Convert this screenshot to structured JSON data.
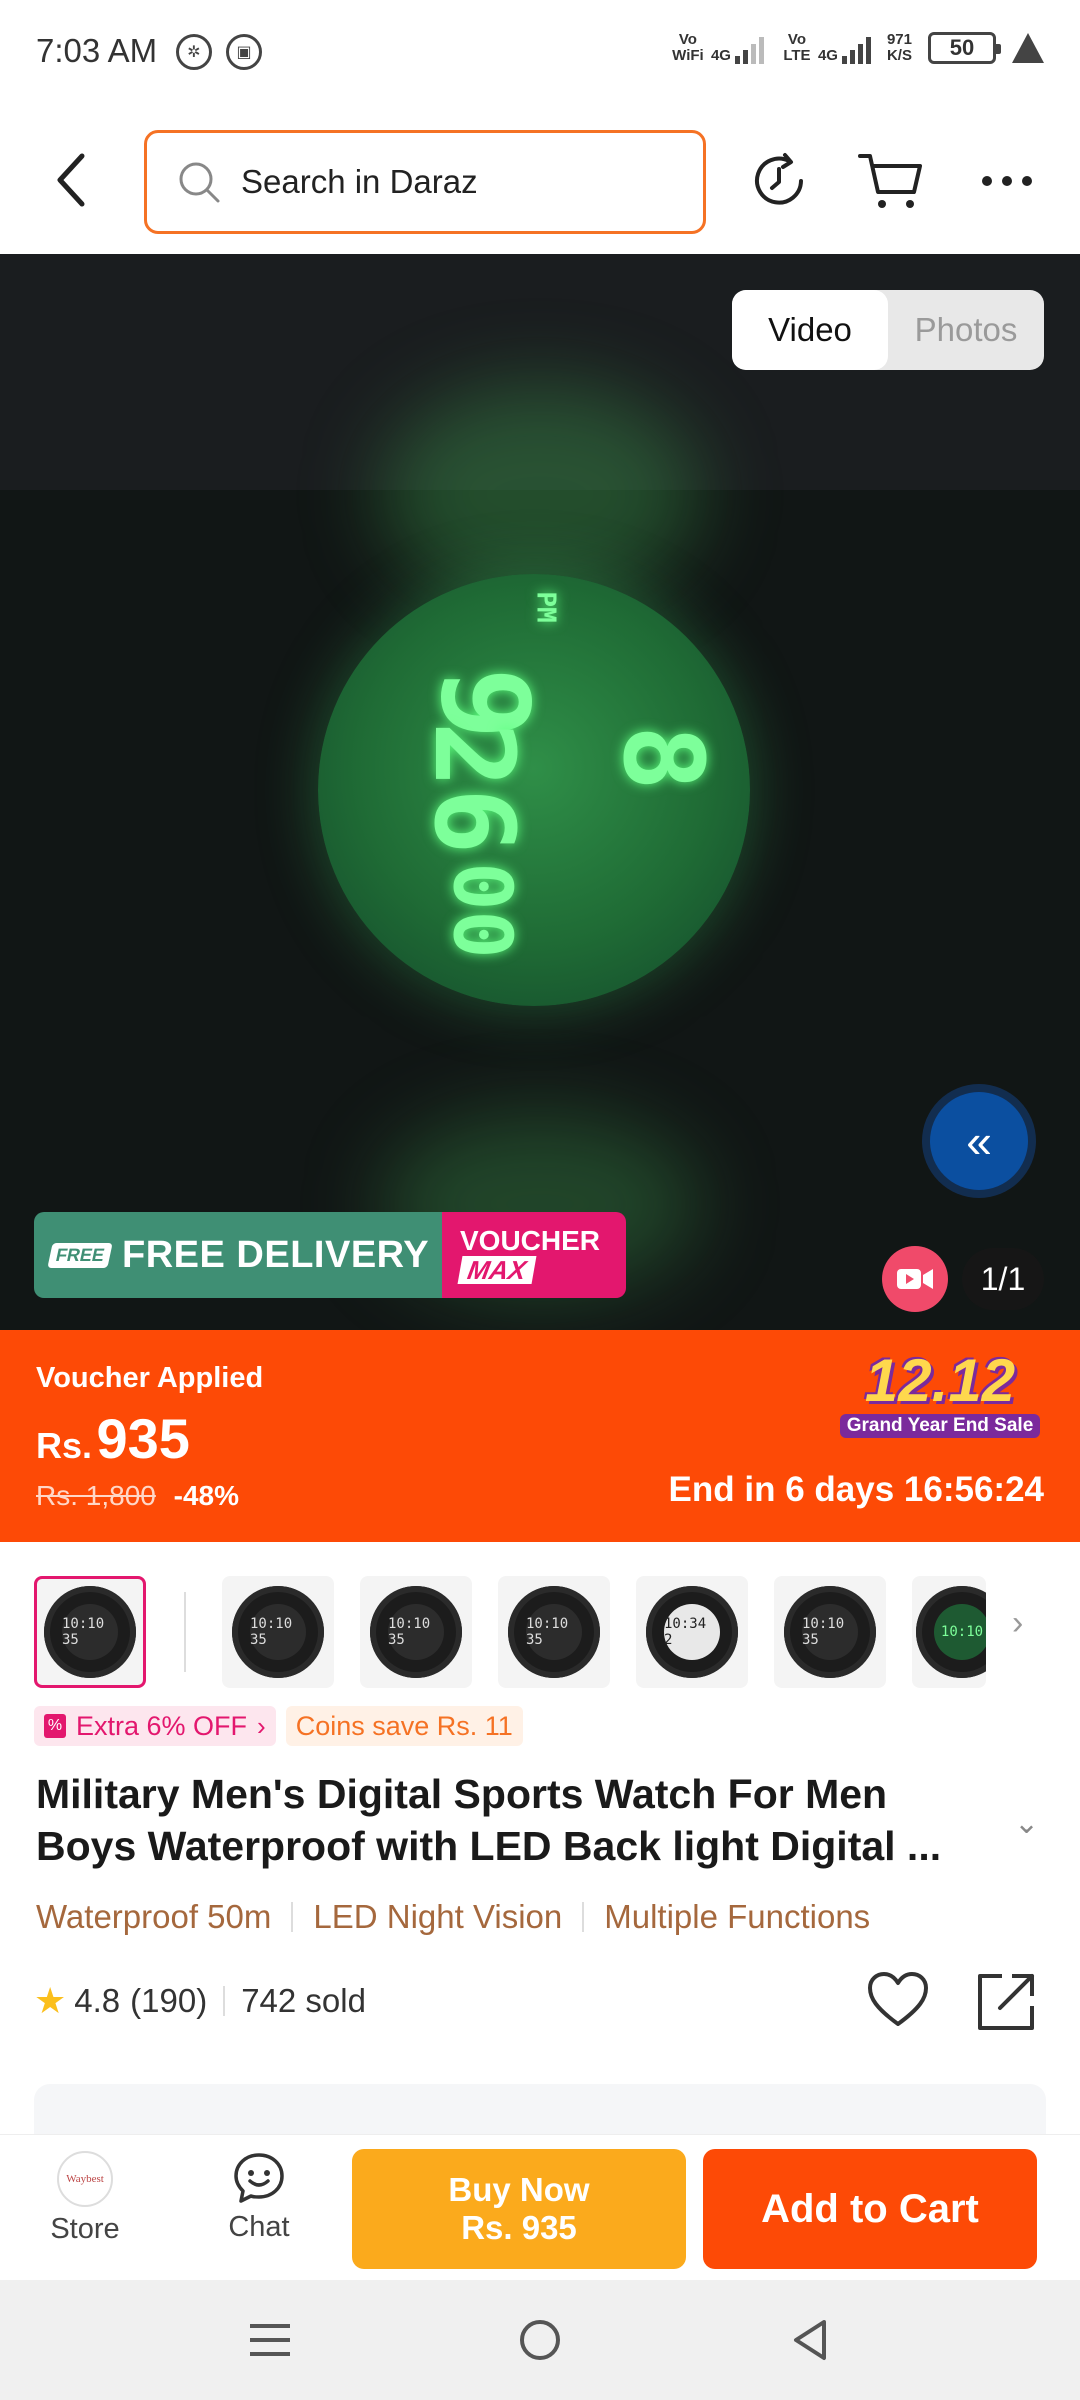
{
  "status_bar": {
    "time": "7:03 AM",
    "sim1_label": "Vo WiFi",
    "sim1_net": "4G",
    "sim2_label": "Vo LTE",
    "sim2_net": "4G",
    "speed_value": "971",
    "speed_unit": "K/S",
    "battery": "50"
  },
  "header": {
    "search_placeholder": "Search in Daraz",
    "icons": [
      "back-arrow-icon",
      "search-icon",
      "history-icon",
      "cart-icon",
      "more-icon"
    ]
  },
  "media": {
    "toggle": {
      "video": "Video",
      "photos": "Photos",
      "active": "video"
    },
    "watch_display": {
      "pm": "PM",
      "hour": "9",
      "minute": "26",
      "seconds": "00",
      "date": "8"
    },
    "promo": {
      "free_tag": "FREE",
      "free_text": "FREE DELIVERY",
      "voucher_line1": "VOUCHER",
      "voucher_line2": "MAX"
    },
    "counter": "1/1",
    "progress": 0.08
  },
  "price": {
    "voucher_applied": "Voucher Applied",
    "currency": "Rs.",
    "current": "935",
    "original": "Rs. 1,800",
    "discount": "-48%",
    "sale_title": "12.12",
    "sale_subtitle": "Grand Year End Sale",
    "countdown": "End in 6 days 16:56:24"
  },
  "thumbnails": [
    {
      "face": "10:10 35",
      "style": "dark"
    },
    {
      "face": "10:10 35",
      "style": "dark"
    },
    {
      "face": "10:10 35",
      "style": "dark"
    },
    {
      "face": "10:10 35",
      "style": "dark"
    },
    {
      "face": "10:34 2",
      "style": "light"
    },
    {
      "face": "10:10 35",
      "style": "dark"
    },
    {
      "face": "10:10",
      "style": "green"
    }
  ],
  "tags": {
    "extra_off": "Extra 6% OFF",
    "coins": "Coins save Rs. 11"
  },
  "product": {
    "title": "Military Men's Digital Sports Watch For Men Boys Waterproof with LED Back light Digital ...",
    "features": [
      "Waterproof 50m",
      "LED Night Vision",
      "Multiple Functions"
    ],
    "rating": "4.8",
    "reviews": "(190)",
    "sold": "742 sold"
  },
  "action_bar": {
    "store": "Store",
    "store_logo": "Waybest",
    "chat": "Chat",
    "buy_now": "Buy Now",
    "buy_now_price": "Rs. 935",
    "add_to_cart": "Add to Cart"
  },
  "colors": {
    "brand_orange": "#fd4a06",
    "buy_now_yellow": "#fbaa1c",
    "accent_pink": "#e3176e",
    "feature_brown": "#a5683d"
  }
}
